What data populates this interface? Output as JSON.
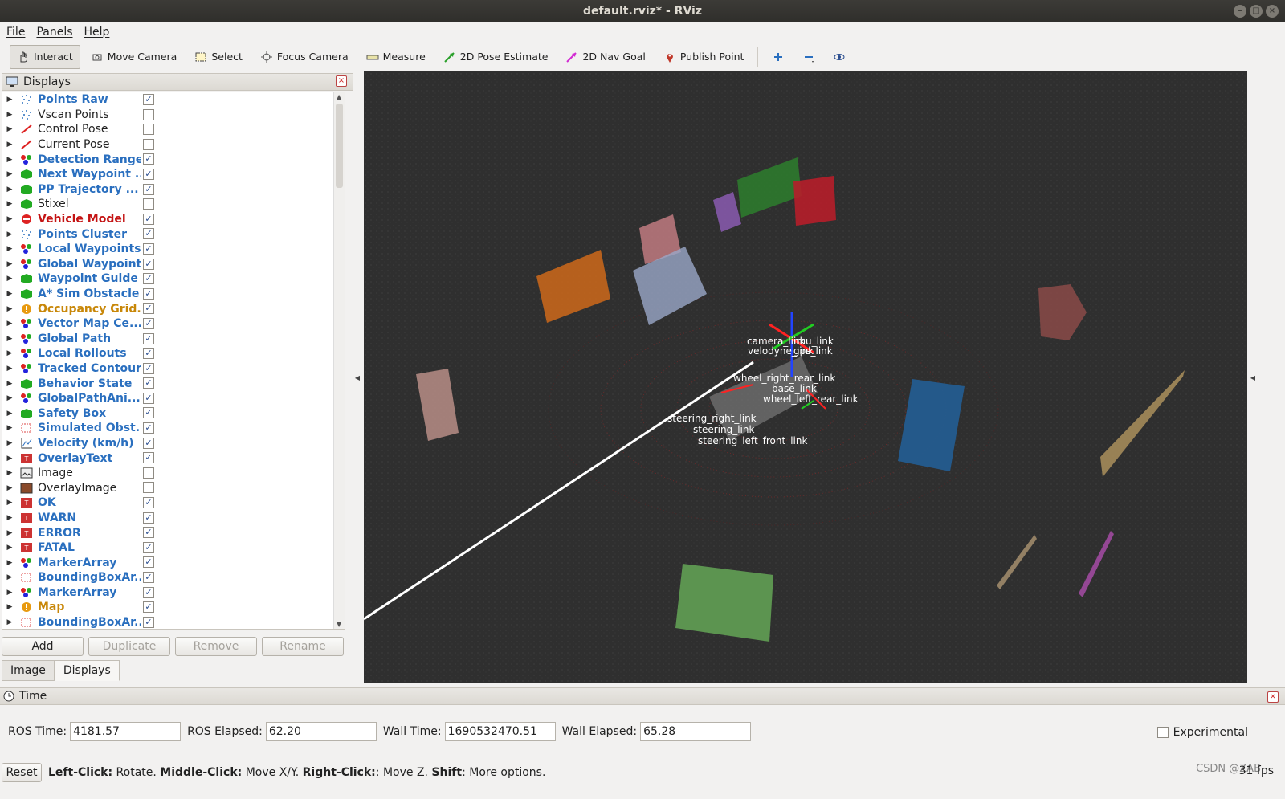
{
  "window": {
    "title": "default.rviz* - RViz"
  },
  "menu": [
    "File",
    "Panels",
    "Help"
  ],
  "toolbar": [
    {
      "label": "Interact",
      "icon": "hand-icon",
      "active": true
    },
    {
      "label": "Move Camera",
      "icon": "move-camera-icon"
    },
    {
      "label": "Select",
      "icon": "select-icon"
    },
    {
      "label": "Focus Camera",
      "icon": "focus-camera-icon"
    },
    {
      "label": "Measure",
      "icon": "ruler-icon"
    },
    {
      "label": "2D Pose Estimate",
      "icon": "pose-arrow-green-icon"
    },
    {
      "label": "2D Nav Goal",
      "icon": "pose-arrow-magenta-icon"
    },
    {
      "label": "Publish Point",
      "icon": "map-pin-icon"
    }
  ],
  "displays": {
    "title": "Displays",
    "items": [
      {
        "label": "Points Raw",
        "style": "blue",
        "checked": true,
        "icon": "points-icon"
      },
      {
        "label": "Vscan Points",
        "style": "normal",
        "checked": false,
        "icon": "points-icon"
      },
      {
        "label": "Control Pose",
        "style": "normal",
        "checked": false,
        "icon": "pose-icon"
      },
      {
        "label": "Current Pose",
        "style": "normal",
        "checked": false,
        "icon": "pose-icon"
      },
      {
        "label": "Detection Range",
        "style": "blue",
        "checked": true,
        "icon": "marker-array-icon"
      },
      {
        "label": "Next Waypoint ...",
        "style": "blue",
        "checked": true,
        "icon": "marker-icon"
      },
      {
        "label": "PP Trajectory ...",
        "style": "blue",
        "checked": true,
        "icon": "marker-icon"
      },
      {
        "label": "Stixel",
        "style": "normal",
        "checked": false,
        "icon": "marker-icon"
      },
      {
        "label": "Vehicle Model",
        "style": "red",
        "checked": true,
        "icon": "error-icon"
      },
      {
        "label": "Points Cluster",
        "style": "blue",
        "checked": true,
        "icon": "points-icon"
      },
      {
        "label": "Local Waypoints",
        "style": "blue",
        "checked": true,
        "icon": "marker-array-icon"
      },
      {
        "label": "Global Waypoints",
        "style": "blue",
        "checked": true,
        "icon": "marker-array-icon"
      },
      {
        "label": "Waypoint Guide",
        "style": "blue",
        "checked": true,
        "icon": "marker-icon"
      },
      {
        "label": "A* Sim Obstacle",
        "style": "blue",
        "checked": true,
        "icon": "marker-icon"
      },
      {
        "label": "Occupancy Grid...",
        "style": "orange",
        "checked": true,
        "icon": "warning-icon"
      },
      {
        "label": "Vector Map Ce...",
        "style": "blue",
        "checked": true,
        "icon": "marker-array-icon"
      },
      {
        "label": "Global Path",
        "style": "blue",
        "checked": true,
        "icon": "marker-array-icon"
      },
      {
        "label": "Local Rollouts",
        "style": "blue",
        "checked": true,
        "icon": "marker-array-icon"
      },
      {
        "label": "Tracked Contours",
        "style": "blue",
        "checked": true,
        "icon": "marker-array-icon"
      },
      {
        "label": "Behavior State",
        "style": "blue",
        "checked": true,
        "icon": "marker-icon"
      },
      {
        "label": "GlobalPathAni...",
        "style": "blue",
        "checked": true,
        "icon": "marker-array-icon"
      },
      {
        "label": "Safety Box",
        "style": "blue",
        "checked": true,
        "icon": "marker-icon"
      },
      {
        "label": "Simulated Obst...",
        "style": "blue",
        "checked": true,
        "icon": "bounding-box-icon"
      },
      {
        "label": "Velocity (km/h)",
        "style": "blue",
        "checked": true,
        "icon": "plot-icon"
      },
      {
        "label": "OverlayText",
        "style": "blue",
        "checked": true,
        "icon": "text-icon"
      },
      {
        "label": "Image",
        "style": "normal",
        "checked": false,
        "icon": "image-icon"
      },
      {
        "label": "OverlayImage",
        "style": "normal",
        "checked": false,
        "icon": "overlay-image-icon"
      },
      {
        "label": "OK",
        "style": "blue",
        "checked": true,
        "icon": "text-icon"
      },
      {
        "label": "WARN",
        "style": "blue",
        "checked": true,
        "icon": "text-icon"
      },
      {
        "label": "ERROR",
        "style": "blue",
        "checked": true,
        "icon": "text-icon"
      },
      {
        "label": "FATAL",
        "style": "blue",
        "checked": true,
        "icon": "text-icon"
      },
      {
        "label": "MarkerArray",
        "style": "blue",
        "checked": true,
        "icon": "marker-array-icon"
      },
      {
        "label": "BoundingBoxAr...",
        "style": "blue",
        "checked": true,
        "icon": "bounding-box-icon"
      },
      {
        "label": "MarkerArray",
        "style": "blue",
        "checked": true,
        "icon": "marker-array-icon"
      },
      {
        "label": "Map",
        "style": "orange",
        "checked": true,
        "icon": "warning-icon"
      },
      {
        "label": "BoundingBoxAr...",
        "style": "blue",
        "checked": true,
        "icon": "bounding-box-icon"
      }
    ],
    "buttons": {
      "add": "Add",
      "duplicate": "Duplicate",
      "remove": "Remove",
      "rename": "Rename"
    },
    "tabs": [
      "Image",
      "Displays"
    ]
  },
  "viewport": {
    "frame_labels": [
      "camera_link",
      "velodyne_link",
      "imu_link",
      "gps_link",
      "wheel_right_rear_link",
      "base_link",
      "wheel_left_rear_link",
      "steering_right_link",
      "steering_link",
      "steering_left_front_link"
    ]
  },
  "time": {
    "title": "Time",
    "ros_time_label": "ROS Time:",
    "ros_time": "4181.57",
    "ros_elapsed_label": "ROS Elapsed:",
    "ros_elapsed": "62.20",
    "wall_time_label": "Wall Time:",
    "wall_time": "1690532470.51",
    "wall_elapsed_label": "Wall Elapsed:",
    "wall_elapsed": "65.28",
    "experimental": "Experimental"
  },
  "status": {
    "reset": "Reset",
    "hint_left": "Left-Click:",
    "hint_left_t": " Rotate. ",
    "hint_middle": "Middle-Click:",
    "hint_middle_t": " Move X/Y. ",
    "hint_right": "Right-Click:",
    "hint_right_t": ": Move Z. ",
    "hint_shift": "Shift",
    "hint_shift_t": ": More options.",
    "fps": "31 fps",
    "watermark": "CSDN @ZAB"
  }
}
